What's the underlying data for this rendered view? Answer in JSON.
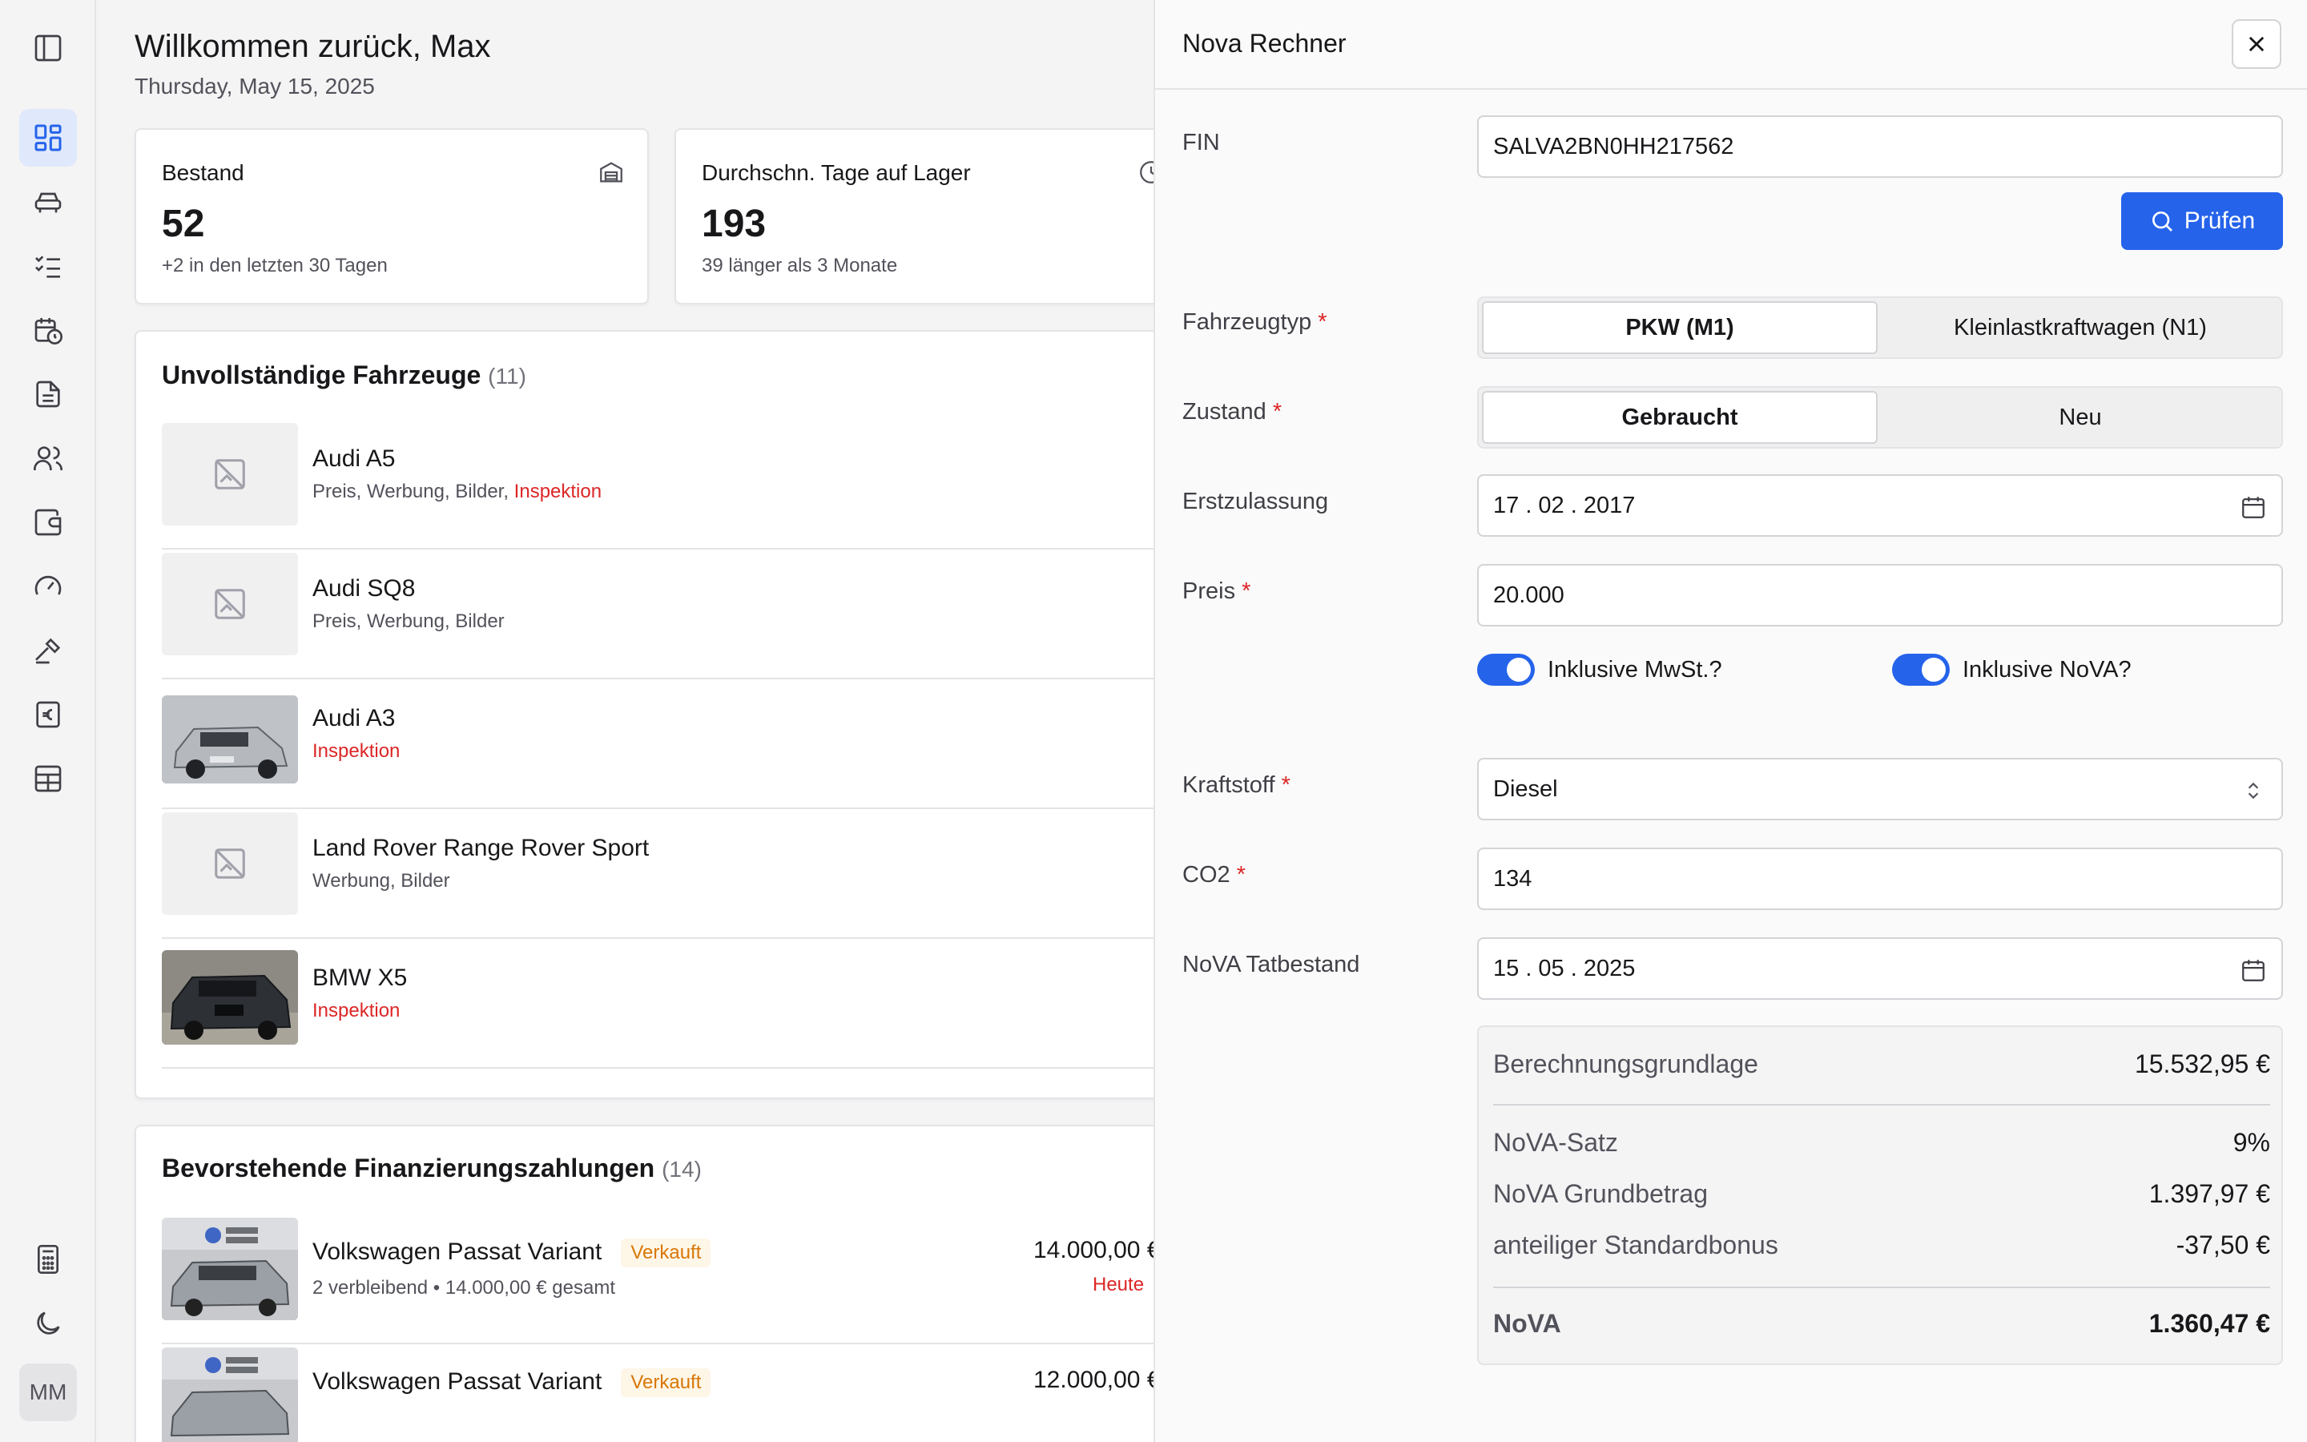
{
  "sidebar": {
    "items": [
      {
        "icon": "panel-toggle-icon"
      },
      {
        "icon": "dashboard-icon",
        "active": true
      },
      {
        "icon": "car-icon"
      },
      {
        "icon": "checklist-icon"
      },
      {
        "icon": "calendar-clock-icon"
      },
      {
        "icon": "document-icon"
      },
      {
        "icon": "users-icon"
      },
      {
        "icon": "wallet-icon"
      },
      {
        "icon": "gauge-icon"
      },
      {
        "icon": "hammer-icon"
      },
      {
        "icon": "euro-receipt-icon"
      },
      {
        "icon": "table-icon"
      },
      {
        "icon": "calculator-icon"
      },
      {
        "icon": "moon-icon"
      }
    ],
    "avatar": "MM"
  },
  "main": {
    "welcome": "Willkommen zurück, Max",
    "date": "Thursday, May 15, 2025",
    "stats": [
      {
        "title": "Bestand",
        "value": "52",
        "sub": "+2 in den letzten 30 Tagen",
        "icon": "warehouse-icon"
      },
      {
        "title": "Durchschn. Tage auf Lager",
        "value": "193",
        "sub": "39 länger als 3 Monate",
        "icon": "clock-icon"
      }
    ],
    "incomplete": {
      "title": "Unvollständige Fahrzeuge",
      "count": "(11)",
      "items": [
        {
          "name": "Audi A5",
          "tags": "Preis, Werbung, Bilder, ",
          "alert": "Inspektion",
          "image": false
        },
        {
          "name": "Audi SQ8",
          "tags": "Preis, Werbung, Bilder",
          "alert": "",
          "image": false
        },
        {
          "name": "Audi A3",
          "tags": "",
          "alert": "Inspektion",
          "image": true
        },
        {
          "name": "Land Rover Range Rover Sport",
          "tags": "Werbung, Bilder",
          "alert": "",
          "image": false
        },
        {
          "name": "BMW X5",
          "tags": "",
          "alert": "Inspektion",
          "image": true
        }
      ]
    },
    "financing": {
      "title": "Bevorstehende Finanzierungszahlungen",
      "count": "(14)",
      "items": [
        {
          "name": "Volkswagen Passat Variant",
          "badge": "Verkauft",
          "detail": "2 verbleibend • 14.000,00 € gesamt",
          "amount": "14.000,00 €",
          "due": "Heute"
        },
        {
          "name": "Volkswagen Passat Variant",
          "badge": "Verkauft",
          "detail": "",
          "amount": "12.000,00 €",
          "due": ""
        }
      ]
    }
  },
  "panel": {
    "title": "Nova Rechner",
    "fin_label": "FIN",
    "fin_value": "SALVA2BN0HH217562",
    "check_button": "Prüfen",
    "vehicle_type_label": "Fahrzeugtyp",
    "vehicle_type_options": [
      "PKW (M1)",
      "Kleinlastkraftwagen (N1)"
    ],
    "condition_label": "Zustand",
    "condition_options": [
      "Gebraucht",
      "Neu"
    ],
    "registration_label": "Erstzulassung",
    "registration_value": "17 . 02 . 2017",
    "price_label": "Preis",
    "price_value": "20.000",
    "toggle_vat": "Inklusive MwSt.?",
    "toggle_nova": "Inklusive NoVA?",
    "fuel_label": "Kraftstoff",
    "fuel_value": "Diesel",
    "co2_label": "CO2",
    "co2_value": "134",
    "nova_date_label": "NoVA Tatbestand",
    "nova_date_value": "15 . 05 . 2025",
    "required_marker": "*",
    "results": {
      "basis_label": "Berechnungsgrundlage",
      "basis_value": "15.532,95 €",
      "rate_label": "NoVA-Satz",
      "rate_value": "9%",
      "base_amount_label": "NoVA Grundbetrag",
      "base_amount_value": "1.397,97 €",
      "bonus_label": "anteiliger Standardbonus",
      "bonus_value": "-37,50 €",
      "total_label": "NoVA",
      "total_value": "1.360,47 €"
    }
  },
  "colors": {
    "accent": "#2563eb",
    "alert": "#dc2626",
    "sold": "#d97706"
  }
}
